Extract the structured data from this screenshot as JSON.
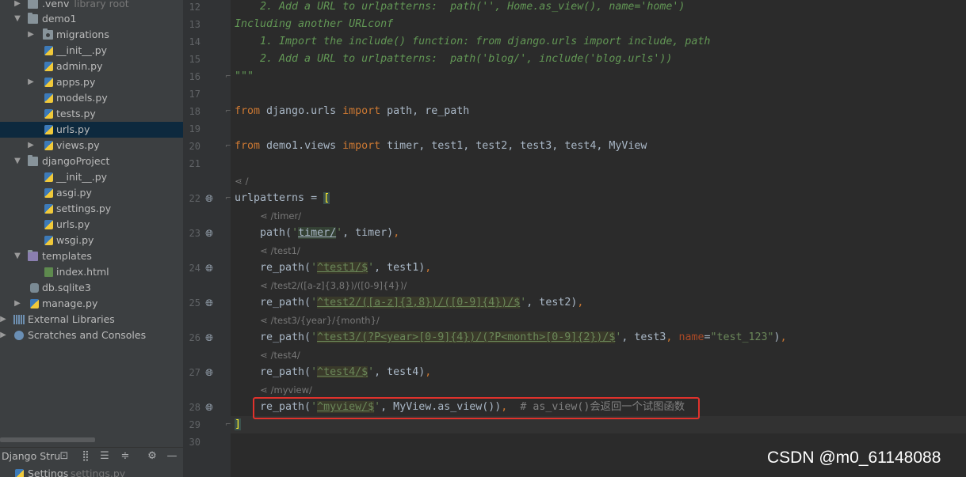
{
  "project_tree": {
    "items": [
      {
        "label": ".venv",
        "hint": "library root",
        "icon": "folder-icon",
        "indent": 1,
        "expanded": false
      },
      {
        "label": "demo1",
        "icon": "folder-icon",
        "indent": 1,
        "expanded": true
      },
      {
        "label": "migrations",
        "icon": "package-icon",
        "indent": 2,
        "expanded": false
      },
      {
        "label": "__init__.py",
        "icon": "python-file-icon",
        "indent": 3
      },
      {
        "label": "admin.py",
        "icon": "python-file-icon",
        "indent": 3
      },
      {
        "label": "apps.py",
        "icon": "python-file-icon",
        "indent": 2,
        "expanded": false
      },
      {
        "label": "models.py",
        "icon": "python-file-icon",
        "indent": 3
      },
      {
        "label": "tests.py",
        "icon": "python-file-icon",
        "indent": 3
      },
      {
        "label": "urls.py",
        "icon": "python-file-icon",
        "indent": 3,
        "selected": true
      },
      {
        "label": "views.py",
        "icon": "python-file-icon",
        "indent": 2,
        "expanded": false
      },
      {
        "label": "djangoProject",
        "icon": "folder-icon",
        "indent": 1,
        "expanded": true
      },
      {
        "label": "__init__.py",
        "icon": "python-file-icon",
        "indent": 3
      },
      {
        "label": "asgi.py",
        "icon": "python-file-icon",
        "indent": 3
      },
      {
        "label": "settings.py",
        "icon": "python-file-icon",
        "indent": 3
      },
      {
        "label": "urls.py",
        "icon": "python-file-icon",
        "indent": 3
      },
      {
        "label": "wsgi.py",
        "icon": "python-file-icon",
        "indent": 3
      },
      {
        "label": "templates",
        "icon": "folder-icon",
        "indent": 1,
        "expanded": true
      },
      {
        "label": "index.html",
        "icon": "html-file-icon",
        "indent": 3
      },
      {
        "label": "db.sqlite3",
        "icon": "database-file-icon",
        "indent": 2
      },
      {
        "label": "manage.py",
        "icon": "python-file-icon",
        "indent": 1,
        "expanded": false
      },
      {
        "label": "External Libraries",
        "icon": "library-icon",
        "indent": 0,
        "expanded": false
      },
      {
        "label": "Scratches and Consoles",
        "icon": "scratch-icon",
        "indent": 0,
        "expanded": false
      }
    ]
  },
  "structure_panel": {
    "title": "Django Stru",
    "item_label": "Settings",
    "item_hint": "settings.py",
    "toolbar_icons": [
      "sort-visibility-icon",
      "sort-alpha-icon",
      "expand-all-icon",
      "collapse-all-icon",
      "gear-icon",
      "minimize-icon"
    ]
  },
  "editor": {
    "line_numbers": {
      "l12": "12",
      "l13": "13",
      "l14": "14",
      "l15": "15",
      "l16": "16",
      "l17": "17",
      "l18": "18",
      "l19": "19",
      "l20": "20",
      "l21": "21",
      "l22": "22",
      "l23": "23",
      "l24": "24",
      "l25": "25",
      "l26": "26",
      "l27": "27",
      "l28": "28",
      "l29": "29",
      "l30": "30"
    },
    "url_hints": {
      "root": "/",
      "timer": "/timer/",
      "test1": "/test1/",
      "test2": "/test2/([a-z]{3,8})/([0-9]{4})/",
      "test3": "/test3/{year}/{month}/",
      "test4": "/test4/",
      "myview": "/myview/"
    },
    "code": {
      "l12": "    2. Add a URL to urlpatterns:  path('', Home.as_view(), name='home')",
      "l13": "Including another URLconf",
      "l14": "    1. Import the include() function: from django.urls import include, path",
      "l15": "    2. Add a URL to urlpatterns:  path('blog/', include('blog.urls'))",
      "l16": "\"\"\"",
      "l18_kw1": "from",
      "l18_mod": " django.urls ",
      "l18_kw2": "import",
      "l18_names": " path, re_path",
      "l20_kw1": "from",
      "l20_mod": " demo1.views ",
      "l20_kw2": "import",
      "l20_names": " timer, test1, test2, test3, test4, MyView",
      "l22_name": "urlpatterns = ",
      "l22_bracket": "[",
      "l23_a": "    path(",
      "l23_q1": "'",
      "l23_s": "timer/",
      "l23_q2": "'",
      "l23_b": ", timer)",
      "l23_c": ",",
      "l24_a": "    re_path(",
      "l24_q1": "'",
      "l24_s": "^test1/$",
      "l24_q2": "'",
      "l24_b": ", test1)",
      "l24_c": ",",
      "l25_a": "    re_path(",
      "l25_q1": "'",
      "l25_s": "^test2/([a-z]{3,8})/([0-9]{4})/$",
      "l25_q2": "'",
      "l25_b": ", test2)",
      "l25_c": ",",
      "l26_a": "    re_path(",
      "l26_q1": "'",
      "l26_s": "^test3/(?P<year>[0-9]{4})/(?P<month>[0-9]{2})/$",
      "l26_q2": "'",
      "l26_b": ", test3",
      "l26_c": ", ",
      "l26_p": "name",
      "l26_eq": "=",
      "l26_v": "\"test_123\"",
      "l26_d": ")",
      "l26_e": ",",
      "l27_a": "    re_path(",
      "l27_q1": "'",
      "l27_s": "^test4/$",
      "l27_q2": "'",
      "l27_b": ", test4)",
      "l27_c": ",",
      "l28_a": "    re_path(",
      "l28_q1": "'",
      "l28_s": "^myview/$",
      "l28_q2": "'",
      "l28_b": ", MyView.as_view())",
      "l28_c": ",  ",
      "l28_cm": "# as_view()会返回一个试图函数",
      "l29_bracket": "]"
    }
  },
  "watermark": "CSDN @m0_61148088",
  "colors": {
    "bg": "#2b2b2b",
    "sidebar": "#3c3f41",
    "selection": "#0d293e",
    "keyword": "#cc7832",
    "string": "#6a8759",
    "comment": "#629755",
    "highlight_box": "#e0322c"
  }
}
